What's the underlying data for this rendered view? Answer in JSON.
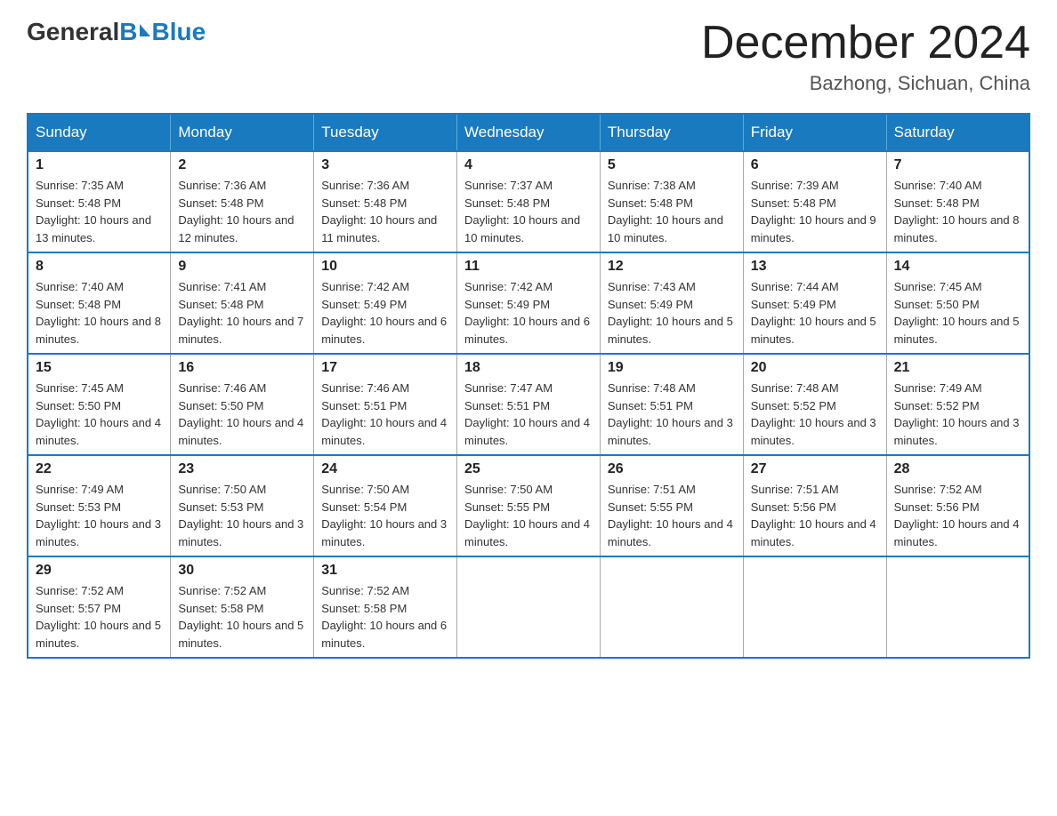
{
  "header": {
    "logo_general": "General",
    "logo_blue": "Blue",
    "month_year": "December 2024",
    "location": "Bazhong, Sichuan, China"
  },
  "days_of_week": [
    "Sunday",
    "Monday",
    "Tuesday",
    "Wednesday",
    "Thursday",
    "Friday",
    "Saturday"
  ],
  "weeks": [
    [
      {
        "day": "1",
        "sunrise": "7:35 AM",
        "sunset": "5:48 PM",
        "daylight": "10 hours and 13 minutes."
      },
      {
        "day": "2",
        "sunrise": "7:36 AM",
        "sunset": "5:48 PM",
        "daylight": "10 hours and 12 minutes."
      },
      {
        "day": "3",
        "sunrise": "7:36 AM",
        "sunset": "5:48 PM",
        "daylight": "10 hours and 11 minutes."
      },
      {
        "day": "4",
        "sunrise": "7:37 AM",
        "sunset": "5:48 PM",
        "daylight": "10 hours and 10 minutes."
      },
      {
        "day": "5",
        "sunrise": "7:38 AM",
        "sunset": "5:48 PM",
        "daylight": "10 hours and 10 minutes."
      },
      {
        "day": "6",
        "sunrise": "7:39 AM",
        "sunset": "5:48 PM",
        "daylight": "10 hours and 9 minutes."
      },
      {
        "day": "7",
        "sunrise": "7:40 AM",
        "sunset": "5:48 PM",
        "daylight": "10 hours and 8 minutes."
      }
    ],
    [
      {
        "day": "8",
        "sunrise": "7:40 AM",
        "sunset": "5:48 PM",
        "daylight": "10 hours and 8 minutes."
      },
      {
        "day": "9",
        "sunrise": "7:41 AM",
        "sunset": "5:48 PM",
        "daylight": "10 hours and 7 minutes."
      },
      {
        "day": "10",
        "sunrise": "7:42 AM",
        "sunset": "5:49 PM",
        "daylight": "10 hours and 6 minutes."
      },
      {
        "day": "11",
        "sunrise": "7:42 AM",
        "sunset": "5:49 PM",
        "daylight": "10 hours and 6 minutes."
      },
      {
        "day": "12",
        "sunrise": "7:43 AM",
        "sunset": "5:49 PM",
        "daylight": "10 hours and 5 minutes."
      },
      {
        "day": "13",
        "sunrise": "7:44 AM",
        "sunset": "5:49 PM",
        "daylight": "10 hours and 5 minutes."
      },
      {
        "day": "14",
        "sunrise": "7:45 AM",
        "sunset": "5:50 PM",
        "daylight": "10 hours and 5 minutes."
      }
    ],
    [
      {
        "day": "15",
        "sunrise": "7:45 AM",
        "sunset": "5:50 PM",
        "daylight": "10 hours and 4 minutes."
      },
      {
        "day": "16",
        "sunrise": "7:46 AM",
        "sunset": "5:50 PM",
        "daylight": "10 hours and 4 minutes."
      },
      {
        "day": "17",
        "sunrise": "7:46 AM",
        "sunset": "5:51 PM",
        "daylight": "10 hours and 4 minutes."
      },
      {
        "day": "18",
        "sunrise": "7:47 AM",
        "sunset": "5:51 PM",
        "daylight": "10 hours and 4 minutes."
      },
      {
        "day": "19",
        "sunrise": "7:48 AM",
        "sunset": "5:51 PM",
        "daylight": "10 hours and 3 minutes."
      },
      {
        "day": "20",
        "sunrise": "7:48 AM",
        "sunset": "5:52 PM",
        "daylight": "10 hours and 3 minutes."
      },
      {
        "day": "21",
        "sunrise": "7:49 AM",
        "sunset": "5:52 PM",
        "daylight": "10 hours and 3 minutes."
      }
    ],
    [
      {
        "day": "22",
        "sunrise": "7:49 AM",
        "sunset": "5:53 PM",
        "daylight": "10 hours and 3 minutes."
      },
      {
        "day": "23",
        "sunrise": "7:50 AM",
        "sunset": "5:53 PM",
        "daylight": "10 hours and 3 minutes."
      },
      {
        "day": "24",
        "sunrise": "7:50 AM",
        "sunset": "5:54 PM",
        "daylight": "10 hours and 3 minutes."
      },
      {
        "day": "25",
        "sunrise": "7:50 AM",
        "sunset": "5:55 PM",
        "daylight": "10 hours and 4 minutes."
      },
      {
        "day": "26",
        "sunrise": "7:51 AM",
        "sunset": "5:55 PM",
        "daylight": "10 hours and 4 minutes."
      },
      {
        "day": "27",
        "sunrise": "7:51 AM",
        "sunset": "5:56 PM",
        "daylight": "10 hours and 4 minutes."
      },
      {
        "day": "28",
        "sunrise": "7:52 AM",
        "sunset": "5:56 PM",
        "daylight": "10 hours and 4 minutes."
      }
    ],
    [
      {
        "day": "29",
        "sunrise": "7:52 AM",
        "sunset": "5:57 PM",
        "daylight": "10 hours and 5 minutes."
      },
      {
        "day": "30",
        "sunrise": "7:52 AM",
        "sunset": "5:58 PM",
        "daylight": "10 hours and 5 minutes."
      },
      {
        "day": "31",
        "sunrise": "7:52 AM",
        "sunset": "5:58 PM",
        "daylight": "10 hours and 6 minutes."
      },
      null,
      null,
      null,
      null
    ]
  ],
  "labels": {
    "sunrise_prefix": "Sunrise: ",
    "sunset_prefix": "Sunset: ",
    "daylight_prefix": "Daylight: "
  }
}
